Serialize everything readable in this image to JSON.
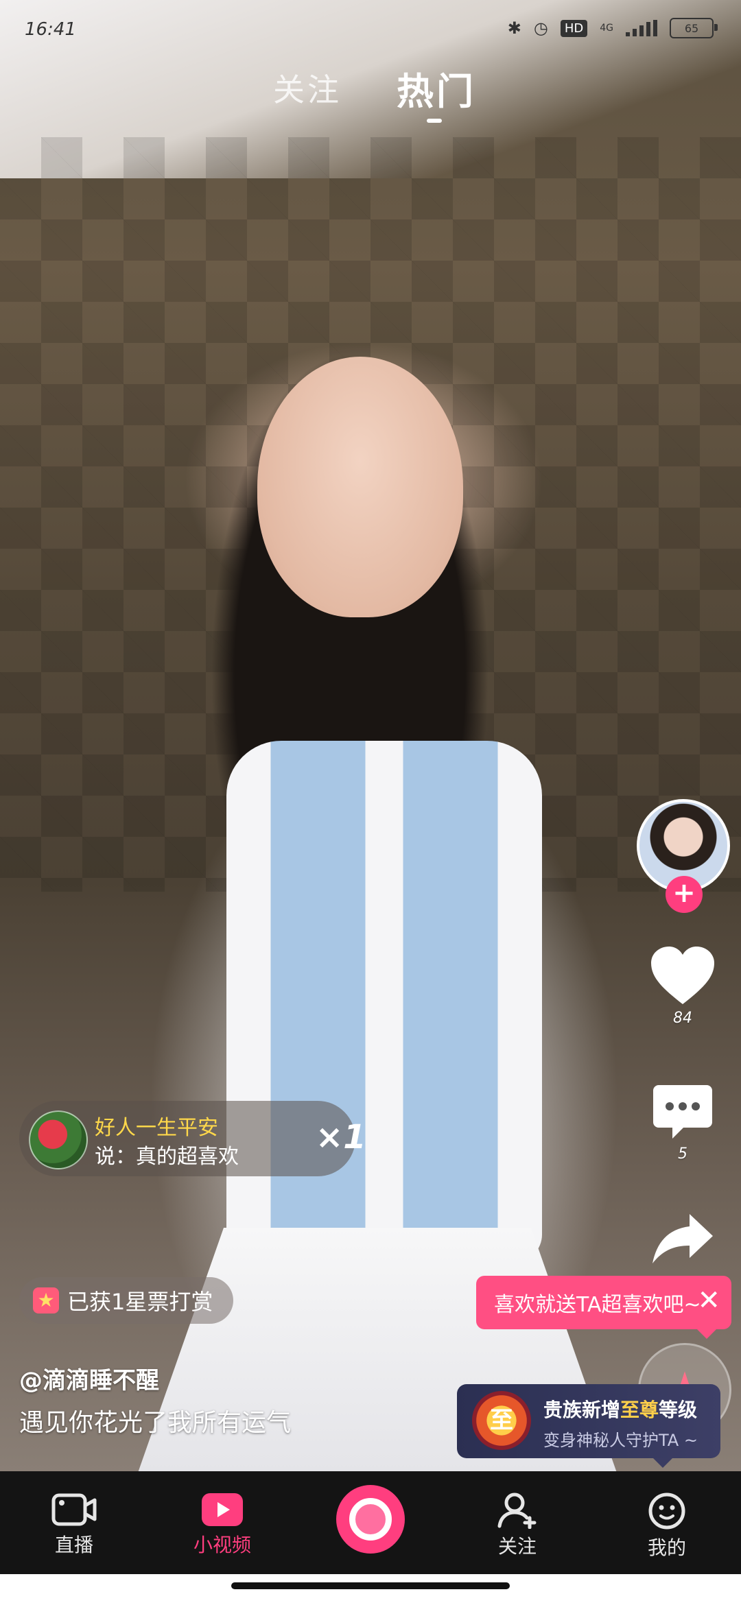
{
  "status_bar": {
    "time": "16:41",
    "hd": "HD",
    "network": "4G",
    "battery": "65"
  },
  "top_tabs": [
    {
      "label": "关注"
    },
    {
      "label": "热门"
    }
  ],
  "actions": {
    "like_count": "84",
    "comment_count": "5"
  },
  "gift_toast": {
    "sender": "好人一生平安",
    "message": "说：真的超喜欢",
    "multiplier": "×1"
  },
  "star_chip": {
    "text": "已获1星票打赏"
  },
  "author": "@滴滴睡不醒",
  "caption": "遇见你花光了我所有运气",
  "superlike_prompt": {
    "text": "喜欢就送TA超喜欢吧~",
    "close": "✕"
  },
  "noble_banner": {
    "badge": "至",
    "title_prefix": "贵族新增",
    "title_highlight": "至尊",
    "title_suffix": "等级",
    "subtitle": "变身神秘人守护TA ~"
  },
  "bottom_nav": [
    {
      "label": "直播",
      "icon": "live-camera-icon"
    },
    {
      "label": "小视频",
      "icon": "play-icon"
    },
    {
      "label": "",
      "icon": "record-icon"
    },
    {
      "label": "关注",
      "icon": "add-user-icon"
    },
    {
      "label": "我的",
      "icon": "face-icon"
    }
  ],
  "colors": {
    "accent": "#ff3e7f",
    "prompt": "#ff4f83",
    "gift_name": "#ffd84a",
    "nav_bg": "#141414"
  }
}
